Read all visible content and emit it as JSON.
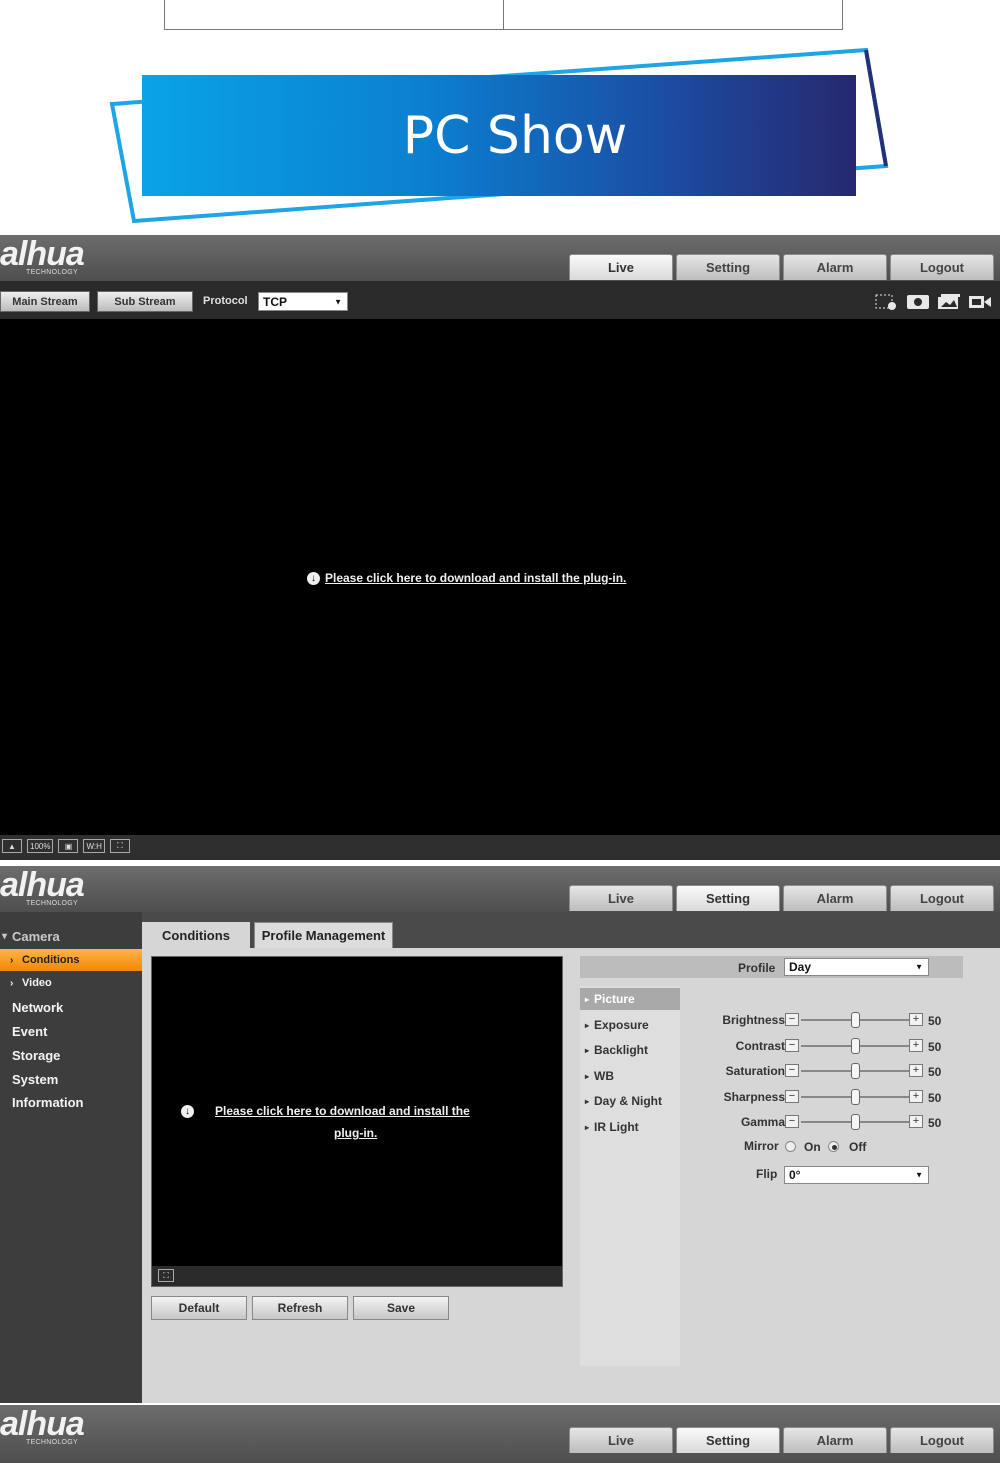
{
  "banner": {
    "title": "PC Show"
  },
  "brand": {
    "logo_word": "alhua",
    "logo_sub": "TECHNOLOGY"
  },
  "nav": [
    "Live",
    "Setting",
    "Alarm",
    "Logout"
  ],
  "live": {
    "main_stream": "Main Stream",
    "sub_stream": "Sub Stream",
    "protocol_label": "Protocol",
    "protocol_value": "TCP",
    "toolbar_icons": [
      "region-zoom-icon",
      "snapshot-icon",
      "triple-snapshot-icon",
      "record-icon"
    ],
    "plugin_message": "Please click here to download and install the plug-in.",
    "bottom_icons": [
      "warning-icon",
      "100%",
      "fit-icon",
      "wh",
      "fullscreen-icon"
    ],
    "bottom_labels": {
      "percent": "100%",
      "wh": "W:H"
    }
  },
  "setting": {
    "sidebar": [
      {
        "label": "Camera",
        "kind": "head"
      },
      {
        "label": "Conditions",
        "kind": "sub",
        "active": true
      },
      {
        "label": "Video",
        "kind": "sub"
      },
      {
        "label": "Network",
        "kind": "item"
      },
      {
        "label": "Event",
        "kind": "item"
      },
      {
        "label": "Storage",
        "kind": "item"
      },
      {
        "label": "System",
        "kind": "item"
      },
      {
        "label": "Information",
        "kind": "item"
      }
    ],
    "tabs": [
      "Conditions",
      "Profile Management"
    ],
    "plugin_line1": "Please click here to download and install the",
    "plugin_line2": "plug-in.",
    "buttons": [
      "Default",
      "Refresh",
      "Save"
    ],
    "profile_label": "Profile",
    "profile_value": "Day",
    "submenu": [
      "Picture",
      "Exposure",
      "Backlight",
      "WB",
      "Day & Night",
      "IR Light"
    ],
    "sliders": [
      {
        "label": "Brightness",
        "value": 50
      },
      {
        "label": "Contrast",
        "value": 50
      },
      {
        "label": "Saturation",
        "value": 50
      },
      {
        "label": "Sharpness",
        "value": 50
      },
      {
        "label": "Gamma",
        "value": 50
      }
    ],
    "slider_max": 100,
    "mirror_label": "Mirror",
    "mirror_on": "On",
    "mirror_off": "Off",
    "mirror_selected": "Off",
    "flip_label": "Flip",
    "flip_value": "0°"
  }
}
